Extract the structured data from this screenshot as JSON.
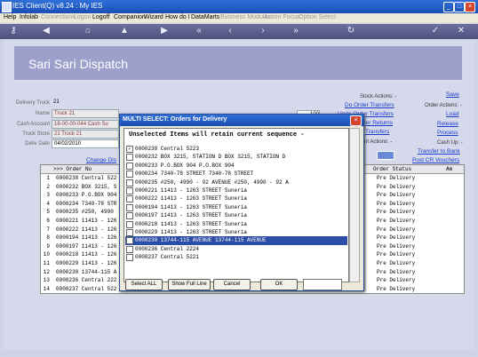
{
  "window": {
    "title": "IES Client(Q) v8.24 : My IES",
    "minimize": "_",
    "maximize": "□",
    "close": "×"
  },
  "menu": [
    "Help",
    "Infolab",
    "Connections",
    "Logon",
    "Logoff",
    "Companion",
    "Wizard",
    "How do I",
    "DataMarts",
    "Business Modules",
    "Action Focus",
    "Option Select"
  ],
  "toolbar": {
    "icons": [
      "key-icon",
      "back-icon",
      "home-icon",
      "up-icon",
      "next-icon",
      "first-icon",
      "prev-icon",
      "forward-icon",
      "last-icon",
      "refresh-icon",
      "check-icon",
      "close-icon"
    ]
  },
  "header": {
    "title": "Sari Sari Dispatch"
  },
  "form": {
    "delivery_truck_label": "Delivery Truck",
    "delivery_truck": "21",
    "name_label": "Name",
    "name": "Truck 21",
    "cash_account_label": "Cash Account",
    "cash_account": "18-00-00-044 Cash Su",
    "truck_store_label": "Truck Store",
    "truck_store": "21 Truck 21",
    "delivery_date_label": "Deliv Date",
    "delivery_date": "04/02/2010",
    "extra_value": "100",
    "change_link": "Change Dis"
  },
  "actions": {
    "stock_label": "Stock Actions: -",
    "do_order_transfers": "Do Order Transfers",
    "undo_order_transfers": "Undo Order Transfers",
    "order_returns": "der Returns",
    "transfers": "Transfers",
    "save": "Save",
    "order_actions_label": "Order Actions: -",
    "load": "Load",
    "release": "Release",
    "process": "Process",
    "print_actions_label": "nt Actions: -",
    "cash_up_label": "Cash Up: -",
    "transfer_to_bank": "Transfer to Bank",
    "post_cr_vouchers": "Post CR Vouchers"
  },
  "grid": {
    "col_order": ">>> Order No",
    "col_status": "Order Status",
    "col_am": "Am",
    "rows": [
      {
        "n": "1",
        "text": "0000238 Central 522",
        "status": "Pre Delivery"
      },
      {
        "n": "2",
        "text": "0000232 BOX 3215, S",
        "status": "Pre Delivery"
      },
      {
        "n": "3",
        "text": "0000233 P.O.BOX 904",
        "status": "Pre Delivery"
      },
      {
        "n": "4",
        "text": "0000234 7340-78 STR",
        "status": "Pre Delivery"
      },
      {
        "n": "5",
        "text": "0000235 #250, 4990",
        "status": "Pre Delivery"
      },
      {
        "n": "6",
        "text": "0000221 11413 - 126",
        "status": "Pre Delivery"
      },
      {
        "n": "7",
        "text": "0000222 11413 - 126",
        "status": "Pre Delivery"
      },
      {
        "n": "8",
        "text": "0000194 11413 - 126",
        "status": "Pre Delivery"
      },
      {
        "n": "9",
        "text": "0000197 11413 - 126",
        "status": "Pre Delivery"
      },
      {
        "n": "10",
        "text": "0000218 11413 - 126",
        "status": "Pre Delivery"
      },
      {
        "n": "11",
        "text": "0000229 11413 - 126",
        "status": "Pre Delivery"
      },
      {
        "n": "12",
        "text": "0000230 13744-115 A",
        "status": "Pre Delivery"
      },
      {
        "n": "13",
        "text": "0000236 Central 222",
        "status": "Pre Delivery"
      },
      {
        "n": "14",
        "text": "0000237 Central 522",
        "status": "Pre Delivery"
      }
    ]
  },
  "dialog": {
    "title": "MULTI SELECT: Orders for Delivery",
    "subtitle": "Unselected Items will retain current sequence -",
    "items": [
      {
        "text": "0000238 Central 5223",
        "checked": "✓"
      },
      {
        "text": "0000232 BOX 3215, STATION D BOX 3215, STATION D",
        "checked": ""
      },
      {
        "text": "0000233 P.O.BOX 904 P.O.BOX 904",
        "checked": ""
      },
      {
        "text": "0000234 7340-78 STREET 7340-78 STREET",
        "checked": ""
      },
      {
        "text": "0000235 #250, 4990 - 92 AVENUE #250, 4990 - 92 A",
        "checked": ""
      },
      {
        "text": "0000221 11413 - 1263 STREET Suneria",
        "checked": ""
      },
      {
        "text": "0000222 11413 - 1263 STREET Suneria",
        "checked": ""
      },
      {
        "text": "0000194 11413 - 1263 STREET Suneria",
        "checked": ""
      },
      {
        "text": "0000197 11413 - 1263 STREET Suneria",
        "checked": ""
      },
      {
        "text": "0000218 11413 - 1263 STREET Suneria",
        "checked": ""
      },
      {
        "text": "0000229 11413 - 1263 STREET Suneria",
        "checked": ""
      },
      {
        "text": "0000230 13744-115 AVENUE 13744-115 AVENUE",
        "checked": "",
        "selected": true
      },
      {
        "text": "0000236 Central 2224",
        "checked": ""
      },
      {
        "text": "0000237 Central 5221",
        "checked": ""
      }
    ],
    "buttons": {
      "select_all": "Select ALL",
      "show_full_line": "Show Full Line",
      "cancel": "Cancel",
      "ok": "OK"
    },
    "close": "×"
  }
}
